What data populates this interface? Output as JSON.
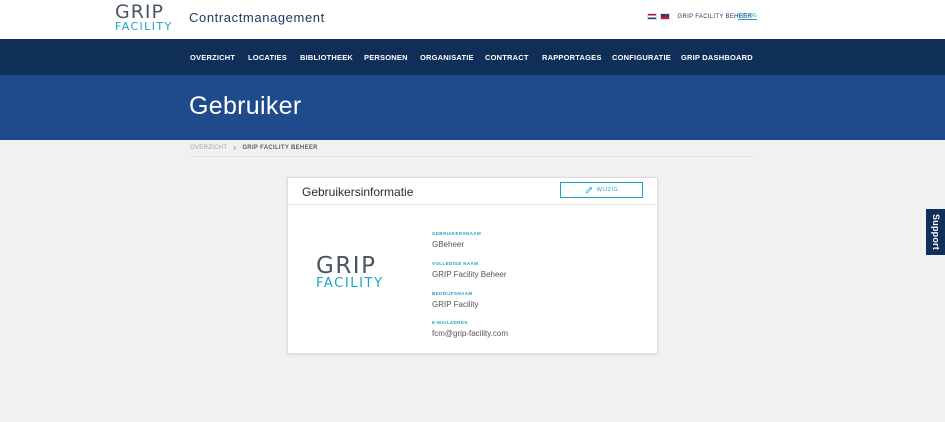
{
  "header": {
    "logo": {
      "line1": "GRIP",
      "line2": "FACILITY"
    },
    "app_title": "Contractmanagement",
    "user_name": "GRIP FACILITY BEHEER",
    "logout_label": "UITLOG"
  },
  "nav": {
    "items": [
      {
        "label": "OVERZICHT"
      },
      {
        "label": "LOCATIES"
      },
      {
        "label": "BIBLIOTHEEK"
      },
      {
        "label": "PERSONEN"
      },
      {
        "label": "ORGANISATIE"
      },
      {
        "label": "CONTRACT"
      },
      {
        "label": "RAPPORTAGES"
      },
      {
        "label": "CONFIGURATIE"
      },
      {
        "label": "GRIP DASHBOARD"
      }
    ]
  },
  "hero": {
    "title": "Gebruiker"
  },
  "breadcrumb": {
    "parent": "OVERZICHT",
    "current": "GRIP FACILITY BEHEER"
  },
  "card": {
    "title": "Gebruikersinformatie",
    "edit_label": "WIJZIG",
    "logo": {
      "line1": "GRIP",
      "line2": "FACILITY"
    },
    "fields": [
      {
        "label": "GEBRUIKERSNAAM",
        "value": "GBeheer"
      },
      {
        "label": "VOLLEDIGE NAAM",
        "value": "GRIP Facility Beheer"
      },
      {
        "label": "BEDRIJFSNAAM",
        "value": "GRIP Facility"
      },
      {
        "label": "E-MAILADRES",
        "value": "fcm@grip-facility.com"
      }
    ]
  },
  "support": {
    "label": "Support"
  },
  "colors": {
    "navy": "#0f2f59",
    "hero_blue": "#1f4b8c",
    "accent": "#1aa3c8"
  },
  "icons": {
    "edit": "pencil-icon",
    "breadcrumb_separator": "chevron-right-icon"
  }
}
